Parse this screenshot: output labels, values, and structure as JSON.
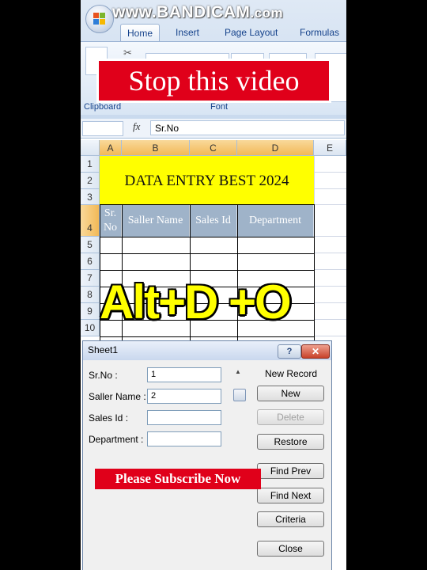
{
  "watermark": {
    "main": "www.BANDICAM",
    "suffix": ".com"
  },
  "ribbon": {
    "tabs": [
      "Home",
      "Insert",
      "Page Layout",
      "Formulas"
    ],
    "active_tab": "Home",
    "groups": [
      "Clipboard",
      "Font"
    ]
  },
  "overlay": {
    "banner": "Stop this video",
    "shortcut": "Alt+D +O",
    "subscribe": "Please Subscribe Now"
  },
  "formula_bar": {
    "fx": "fx",
    "value": "Sr.No"
  },
  "grid": {
    "columns": [
      "A",
      "B",
      "C",
      "D",
      "E"
    ],
    "selected_columns": [
      "A",
      "B",
      "C",
      "D"
    ],
    "rows": [
      "1",
      "2",
      "3",
      "4",
      "5",
      "6",
      "7",
      "8",
      "9",
      "10"
    ],
    "selected_row": "4",
    "title": "DATA ENTRY BEST 2024",
    "headers": [
      "Sr.\nNo",
      "Saller Name",
      "Sales Id",
      "Department"
    ]
  },
  "dialog": {
    "title": "Sheet1",
    "help": "?",
    "close": "✕",
    "fields": [
      {
        "label": "Sr.No :",
        "value": "1"
      },
      {
        "label": "Saller Name :",
        "value": "2"
      },
      {
        "label": "Sales Id :",
        "value": ""
      },
      {
        "label": "Department :",
        "value": ""
      }
    ],
    "status": "New Record",
    "buttons": [
      {
        "label": "New",
        "enabled": true
      },
      {
        "label": "Delete",
        "enabled": false
      },
      {
        "label": "Restore",
        "enabled": true
      },
      {
        "label": "Find Prev",
        "enabled": true
      },
      {
        "label": "Find Next",
        "enabled": true
      },
      {
        "label": "Criteria",
        "enabled": true
      },
      {
        "label": "Close",
        "enabled": true
      }
    ]
  },
  "colors": {
    "title_fill": "#ffff00",
    "header_fill": "#9fb3c9",
    "banner_red": "#e0001a",
    "shortcut_yellow": "#ffff00"
  }
}
